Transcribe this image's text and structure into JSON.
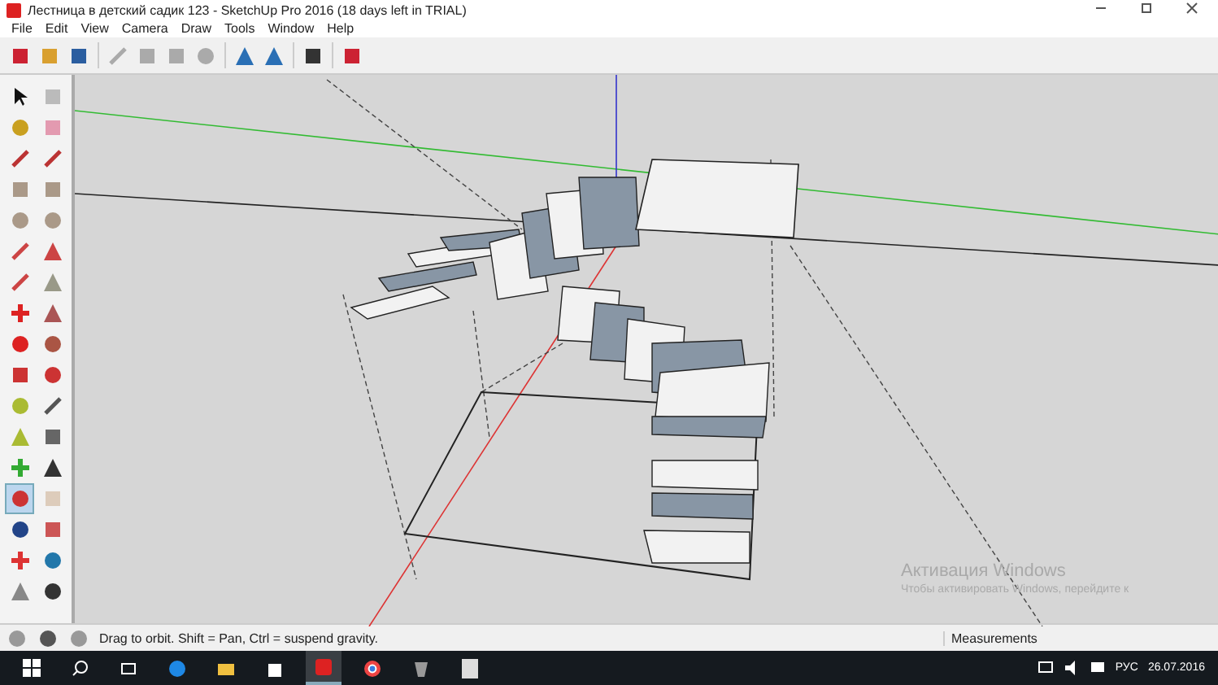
{
  "window": {
    "title": "Лестница в детский садик 123 - SketchUp Pro 2016 (18 days left in TRIAL)"
  },
  "menu": [
    "File",
    "Edit",
    "View",
    "Camera",
    "Draw",
    "Tools",
    "Window",
    "Help"
  ],
  "tools": [
    {
      "selected": false
    },
    {
      "selected": false
    },
    {
      "selected": false
    },
    {
      "selected": false
    },
    {
      "selected": false
    },
    {
      "selected": false
    },
    {
      "selected": false
    },
    {
      "selected": false
    },
    {
      "selected": false
    },
    {
      "selected": false
    },
    {
      "selected": false
    },
    {
      "selected": false
    },
    {
      "selected": false
    },
    {
      "selected": false
    },
    {
      "selected": false
    },
    {
      "selected": false
    },
    {
      "selected": false
    },
    {
      "selected": false
    },
    {
      "selected": false
    },
    {
      "selected": false
    },
    {
      "selected": false
    },
    {
      "selected": false
    },
    {
      "selected": false
    },
    {
      "selected": false
    },
    {
      "selected": false
    },
    {
      "selected": false
    },
    {
      "selected": true
    },
    {
      "selected": false
    },
    {
      "selected": false
    },
    {
      "selected": false
    },
    {
      "selected": false
    },
    {
      "selected": false
    },
    {
      "selected": false
    },
    {
      "selected": false
    }
  ],
  "activation": {
    "title": "Активация Windows",
    "text": "Чтобы активировать Windows, перейдите к"
  },
  "status_bar": {
    "hint": "Drag to orbit. Shift = Pan, Ctrl = suspend gravity.",
    "measurements_label": "Measurements"
  },
  "taskbar": {
    "language": "РУС",
    "date": "26.07.2016"
  }
}
